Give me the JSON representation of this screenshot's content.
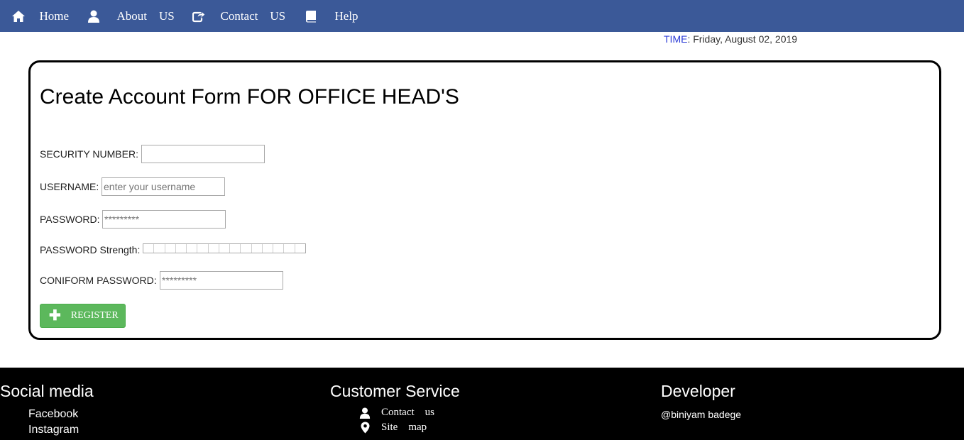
{
  "nav": {
    "items": [
      {
        "label": "Home",
        "icon": "home-icon"
      },
      {
        "label": "About    US",
        "icon": "user-icon"
      },
      {
        "label": "Contact    US",
        "icon": "share-icon"
      },
      {
        "label": "Help",
        "icon": "book-icon"
      }
    ],
    "background": "#3b5998"
  },
  "time": {
    "key": "TIME",
    "value": ": Friday, August 02, 2019"
  },
  "form": {
    "title": "Create Account Form FOR OFFICE HEAD'S",
    "fields": {
      "security_label": "SECURITY NUMBER:",
      "security_value": "",
      "username_label": "USERNAME:",
      "username_placeholder": "enter your username",
      "password_label": "PASSWORD:",
      "password_placeholder": "*********",
      "strength_label": "PASSWORD Strength:",
      "confirm_label": "CONIFORM PASSWORD:",
      "confirm_placeholder": "*********"
    },
    "register_label": "REGISTER",
    "register_color": "#5cb85c"
  },
  "footer": {
    "social": {
      "title": "Social media",
      "links": [
        "Facebook",
        "Instagram"
      ]
    },
    "service": {
      "title": "Customer Service",
      "links": [
        {
          "label": "Contact    us",
          "icon": "user-icon"
        },
        {
          "label": "Site    map",
          "icon": "map-marker-icon"
        }
      ]
    },
    "developer": {
      "title": "Developer",
      "name": "@biniyam badege"
    }
  }
}
